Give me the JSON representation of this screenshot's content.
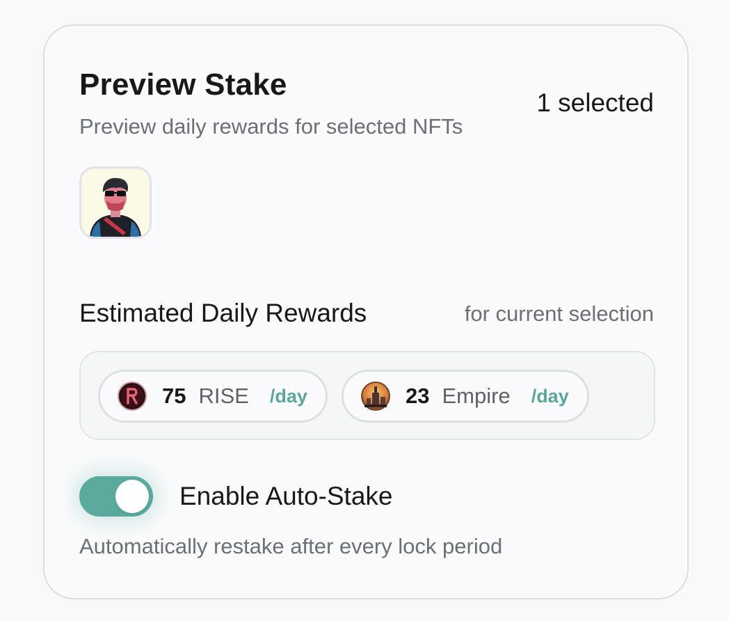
{
  "header": {
    "title": "Preview Stake",
    "subtitle": "Preview daily rewards for selected NFTs",
    "selected_count": "1 selected"
  },
  "selection": {
    "nfts": [
      {
        "icon": "nft-character-avatar-icon"
      }
    ]
  },
  "rewards": {
    "title": "Estimated Daily Rewards",
    "note": "for current selection",
    "tokens": [
      {
        "icon": "rise-token-icon",
        "amount": "75",
        "name": "RISE",
        "unit": "/day"
      },
      {
        "icon": "empire-token-icon",
        "amount": "23",
        "name": "Empire",
        "unit": "/day"
      }
    ]
  },
  "auto_stake": {
    "label": "Enable Auto-Stake",
    "description": "Automatically restake after every lock period",
    "enabled": true
  },
  "colors": {
    "accent": "#5aaa9e",
    "per_day_text": "#5aa69a",
    "muted_text": "#6b6f76",
    "border": "#dcdde1"
  }
}
